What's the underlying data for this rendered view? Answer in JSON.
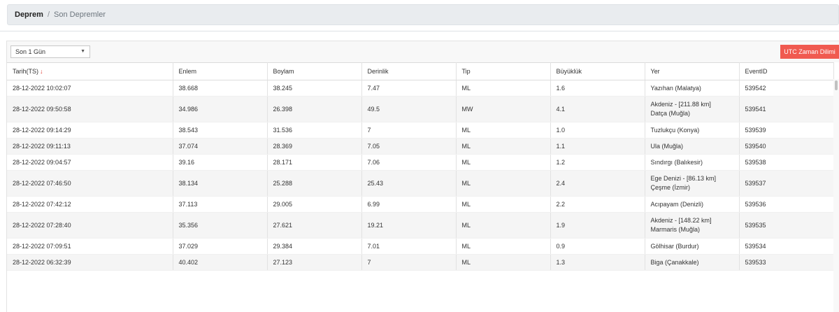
{
  "breadcrumb": {
    "root": "Deprem",
    "separator": "/",
    "current": "Son Depremler"
  },
  "filter": {
    "selected": "Son 1 Gün"
  },
  "utc_button": {
    "label": "UTC Zaman Dilimi",
    "color": "#f05a50"
  },
  "table": {
    "headers": [
      "Tarih(TS)",
      "Enlem",
      "Boylam",
      "Derinlik",
      "Tip",
      "Büyüklük",
      "Yer",
      "EventID"
    ],
    "sort_column": "Tarih(TS)",
    "rows": [
      [
        "28-12-2022 10:02:07",
        "38.668",
        "38.245",
        "7.47",
        "ML",
        "1.6",
        "Yazıhan (Malatya)",
        "539542"
      ],
      [
        "28-12-2022 09:50:58",
        "34.986",
        "26.398",
        "49.5",
        "MW",
        "4.1",
        "Akdeniz - [211.88 km] Datça (Muğla)",
        "539541"
      ],
      [
        "28-12-2022 09:14:29",
        "38.543",
        "31.536",
        "7",
        "ML",
        "1.0",
        "Tuzlukçu (Konya)",
        "539539"
      ],
      [
        "28-12-2022 09:11:13",
        "37.074",
        "28.369",
        "7.05",
        "ML",
        "1.1",
        "Ula (Muğla)",
        "539540"
      ],
      [
        "28-12-2022 09:04:57",
        "39.16",
        "28.171",
        "7.06",
        "ML",
        "1.2",
        "Sındırgı (Balıkesir)",
        "539538"
      ],
      [
        "28-12-2022 07:46:50",
        "38.134",
        "25.288",
        "25.43",
        "ML",
        "2.4",
        "Ege Denizi - [86.13 km] Çeşme (İzmir)",
        "539537"
      ],
      [
        "28-12-2022 07:42:12",
        "37.113",
        "29.005",
        "6.99",
        "ML",
        "2.2",
        "Acıpayam (Denizli)",
        "539536"
      ],
      [
        "28-12-2022 07:28:40",
        "35.356",
        "27.621",
        "19.21",
        "ML",
        "1.9",
        "Akdeniz - [148.22 km] Marmaris (Muğla)",
        "539535"
      ],
      [
        "28-12-2022 07:09:51",
        "37.029",
        "29.384",
        "7.01",
        "ML",
        "0.9",
        "Gölhisar (Burdur)",
        "539534"
      ],
      [
        "28-12-2022 06:32:39",
        "40.402",
        "27.123",
        "7",
        "ML",
        "1.3",
        "Biga (Çanakkale)",
        "539533"
      ]
    ]
  }
}
